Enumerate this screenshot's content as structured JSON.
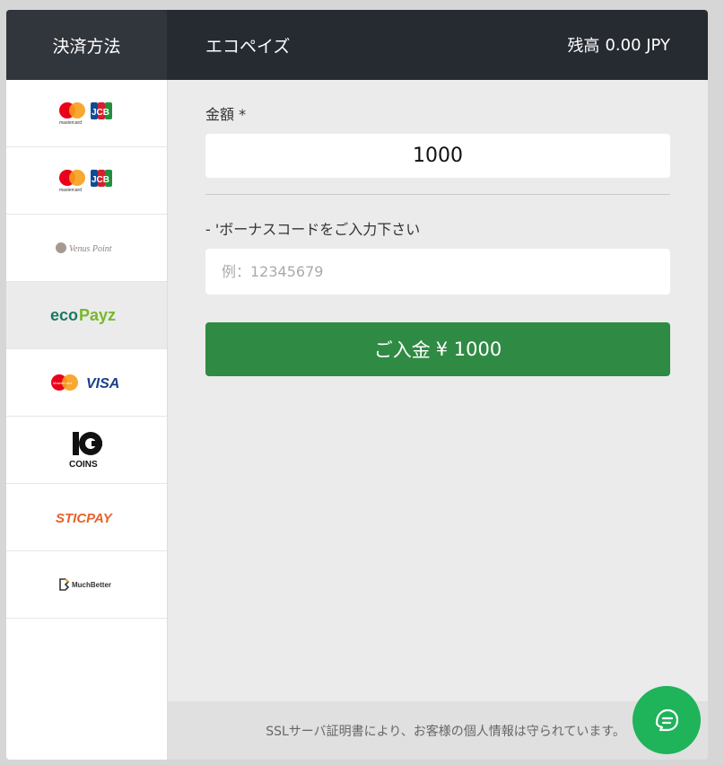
{
  "header": {
    "sidebar_title": "決済方法",
    "method_title": "エコペイズ",
    "balance_label": "残高",
    "balance_value": "0.00 JPY"
  },
  "sidebar": {
    "methods": [
      {
        "name": "mastercard-jcb",
        "logo_text": "mastercard",
        "logo_text2": "JCB"
      },
      {
        "name": "mastercard-jcb-2",
        "logo_text": "mastercard",
        "logo_text2": "JCB"
      },
      {
        "name": "venus-point",
        "logo_text": "Venus Point"
      },
      {
        "name": "ecopayz",
        "logo_text": "eco",
        "logo_text2": "Payz",
        "active": true
      },
      {
        "name": "mastercard-visa",
        "logo_text": "MasterCard",
        "logo_text2": "VISA"
      },
      {
        "name": "10-coins",
        "logo_text": "COINS"
      },
      {
        "name": "sticpay",
        "logo_text": "STICPAY"
      },
      {
        "name": "muchbetter",
        "logo_text": "MuchBetter"
      }
    ]
  },
  "form": {
    "amount_label": "金額 *",
    "amount_value": "1000",
    "bonus_label": "- 'ボーナスコードをご入力下さい",
    "bonus_placeholder": "例：12345679",
    "deposit_label": "ご入金",
    "deposit_amount": "¥ 1000"
  },
  "footer": {
    "ssl_text": "SSLサーバ証明書により、お客様の個人情報は守られています。"
  },
  "colors": {
    "header_bg": "#262a31",
    "deposit_button": "#2f8b43",
    "chat_button": "#1fb35a"
  }
}
